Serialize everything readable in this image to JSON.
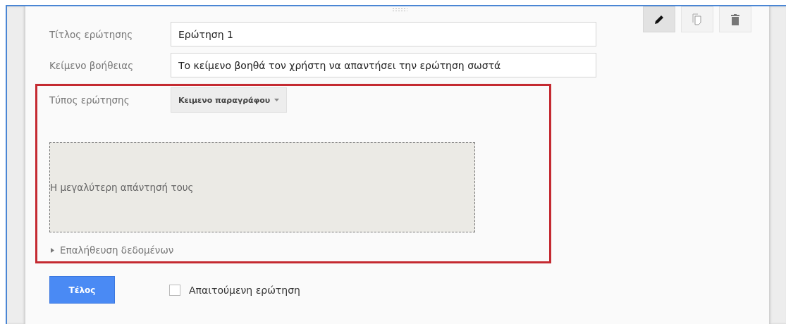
{
  "toolbar": [
    {
      "kind": "edit",
      "selected": true
    },
    {
      "kind": "duplicate",
      "selected": false
    },
    {
      "kind": "delete",
      "selected": false
    }
  ],
  "fields": [
    {
      "label": "Τίτλος ερώτησης",
      "value": "Ερώτηση 1"
    },
    {
      "label": "Κείμενο βοήθειας",
      "value": "Το κείμενο βοηθά τον χρήστη να απαντήσει την ερώτηση σωστά"
    }
  ],
  "question_type": {
    "label": "Τύπος ερώτησης",
    "value": "Κειμενο παραγράφου"
  },
  "answer_preview": {
    "placeholder": "Η μεγαλύτερη απάντησή τους"
  },
  "validation": {
    "label": "Επαλήθευση δεδομένων",
    "expanded": false
  },
  "done_button": "Τέλος",
  "required": {
    "label": "Απαιτούμενη ερώτηση",
    "checked": false
  }
}
